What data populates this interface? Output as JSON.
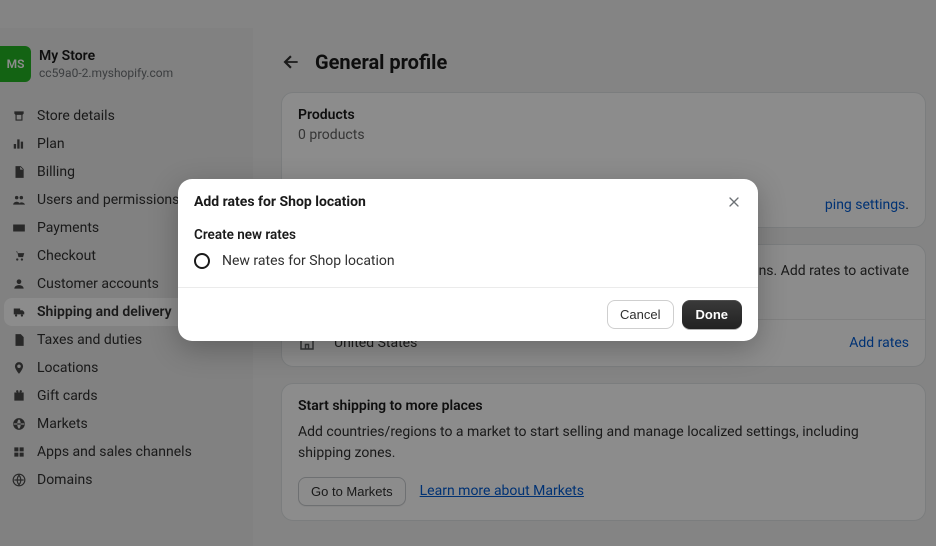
{
  "store": {
    "initials": "MS",
    "name": "My Store",
    "url": "cc59a0-2.myshopify.com"
  },
  "nav": {
    "items": [
      {
        "label": "Store details"
      },
      {
        "label": "Plan"
      },
      {
        "label": "Billing"
      },
      {
        "label": "Users and permissions"
      },
      {
        "label": "Payments"
      },
      {
        "label": "Checkout"
      },
      {
        "label": "Customer accounts"
      },
      {
        "label": "Shipping and delivery"
      },
      {
        "label": "Taxes and duties"
      },
      {
        "label": "Locations"
      },
      {
        "label": "Gift cards"
      },
      {
        "label": "Markets"
      },
      {
        "label": "Apps and sales channels"
      },
      {
        "label": "Domains"
      }
    ]
  },
  "page": {
    "title": "General profile"
  },
  "products": {
    "title": "Products",
    "count_text": "0 products"
  },
  "shipping_link": {
    "suffix": "ping settings",
    "dot": "."
  },
  "origins": {
    "message_part": "ons. Add rates to activate",
    "item_name": "United States",
    "add_rates": "Add rates"
  },
  "markets_card": {
    "title": "Start shipping to more places",
    "description": "Add countries/regions to a market to start selling and manage localized settings, including shipping zones.",
    "button": "Go to Markets",
    "link": "Learn more about Markets"
  },
  "modal": {
    "title": "Add rates for Shop location",
    "section_title": "Create new rates",
    "radio_label": "New rates for Shop location",
    "cancel": "Cancel",
    "done": "Done"
  }
}
